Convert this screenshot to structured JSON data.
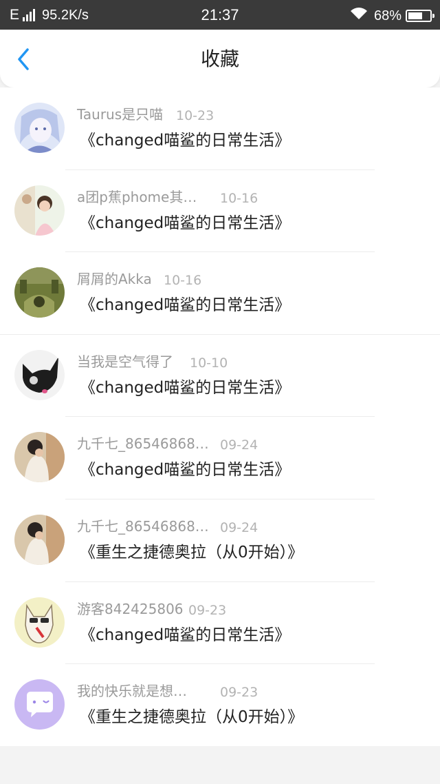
{
  "status_bar": {
    "network": "E",
    "speed": "95.2K/s",
    "time": "21:37",
    "battery": "68%",
    "battery_level": 0.68
  },
  "header": {
    "title": "收藏",
    "back_icon": "chevron-left-icon",
    "accent_color": "#2196f3"
  },
  "favorites": [
    {
      "author": "Taurus是只喵",
      "date": "10-23",
      "work": "《changed喵鲨的日常生活》",
      "avatar": "anime-avatar"
    },
    {
      "author": "a团p蕉phome其…",
      "date": "10-16",
      "work": "《changed喵鲨的日常生活》",
      "avatar": "child-photo-avatar"
    },
    {
      "author": "屑屑的Akka",
      "date": "10-16",
      "work": "《changed喵鲨的日常生活》",
      "avatar": "game-scene-avatar"
    },
    {
      "author": "当我是空气得了",
      "date": "10-10",
      "work": "《changed喵鲨的日常生活》",
      "avatar": "black-cat-avatar"
    },
    {
      "author": "九千七_86546868…",
      "date": "09-24",
      "work": "《changed喵鲨的日常生活》",
      "avatar": "toddler-avatar"
    },
    {
      "author": "九千七_86546868…",
      "date": "09-24",
      "work": "《重生之捷德奥拉（从0开始）》",
      "avatar": "toddler-avatar"
    },
    {
      "author": "游客842425806",
      "date": "09-23",
      "work": "《changed喵鲨的日常生活》",
      "avatar": "cartoon-cat-avatar"
    },
    {
      "author": "我的快乐就是想…",
      "date": "09-23",
      "work": "《重生之捷德奥拉（从0开始）》",
      "avatar": "default-chat-avatar"
    }
  ]
}
